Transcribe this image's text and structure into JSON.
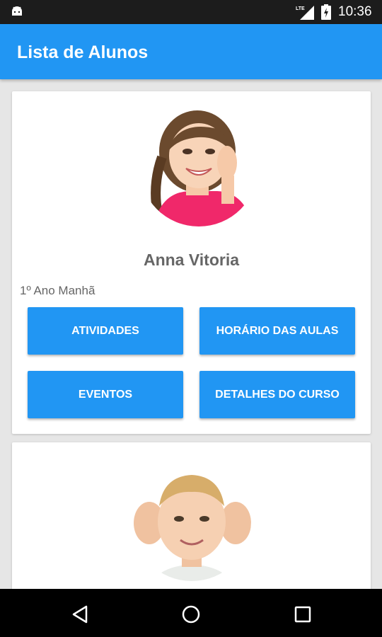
{
  "status_bar": {
    "network": "LTE",
    "time": "10:36"
  },
  "app_bar": {
    "title": "Lista de Alunos"
  },
  "students": [
    {
      "name": "Anna Vitoria",
      "class": "1º Ano Manhã",
      "buttons": {
        "activities": "ATIVIDADES",
        "schedule": "HORÁRIO DAS AULAS",
        "events": "EVENTOS",
        "course_details": "DETALHES DO CURSO"
      }
    },
    {
      "name": "",
      "class": ""
    }
  ],
  "colors": {
    "primary": "#2196f3",
    "status_bar": "#1c1c1c",
    "background": "#e6e6e6",
    "text_secondary": "#666666"
  },
  "icons": [
    "android-icon",
    "lte-signal-icon",
    "battery-icon",
    "back-icon",
    "home-icon",
    "recents-icon"
  ]
}
